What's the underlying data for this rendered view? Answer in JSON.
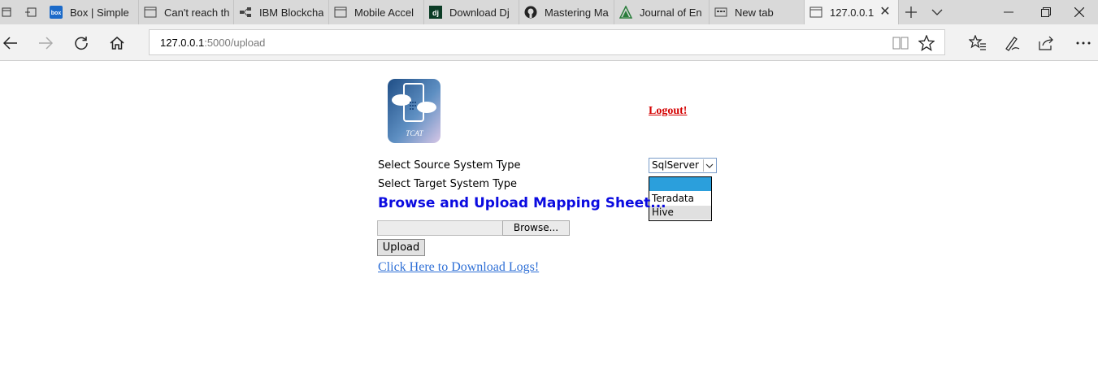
{
  "browser": {
    "tabs": [
      {
        "label": "Box | Simple",
        "icon": "box-icon"
      },
      {
        "label": "Can't reach th",
        "icon": "page-icon"
      },
      {
        "label": "IBM Blockcha",
        "icon": "network-icon"
      },
      {
        "label": "Mobile Accel",
        "icon": "page-icon"
      },
      {
        "label": "Download Dj",
        "icon": "django-icon"
      },
      {
        "label": "Mastering Ma",
        "icon": "github-icon"
      },
      {
        "label": "Journal of En",
        "icon": "journal-icon"
      },
      {
        "label": "New tab",
        "icon": "newtab-icon"
      },
      {
        "label": "127.0.0.1",
        "icon": "page-icon",
        "active": true
      }
    ],
    "url": {
      "host": "127.0.0.1",
      "path": ":5000/upload"
    }
  },
  "page": {
    "logo_text": "TCAT",
    "logout": "Logout!",
    "source_label": "Select Source System Type",
    "target_label": "Select Target System Type",
    "source_select": {
      "value": "SqlServer",
      "options": [
        "",
        "Teradata",
        "Hive"
      ]
    },
    "heading": "Browse and Upload Mapping Sheet...",
    "browse_label": "Browse...",
    "upload_label": "Upload",
    "download_link": "Click Here to Download Logs!"
  },
  "colors": {
    "heading": "#0b0be0",
    "logout": "#d40000",
    "link": "#2e6fd6",
    "dropdown_selected": "#2b9fdc"
  }
}
